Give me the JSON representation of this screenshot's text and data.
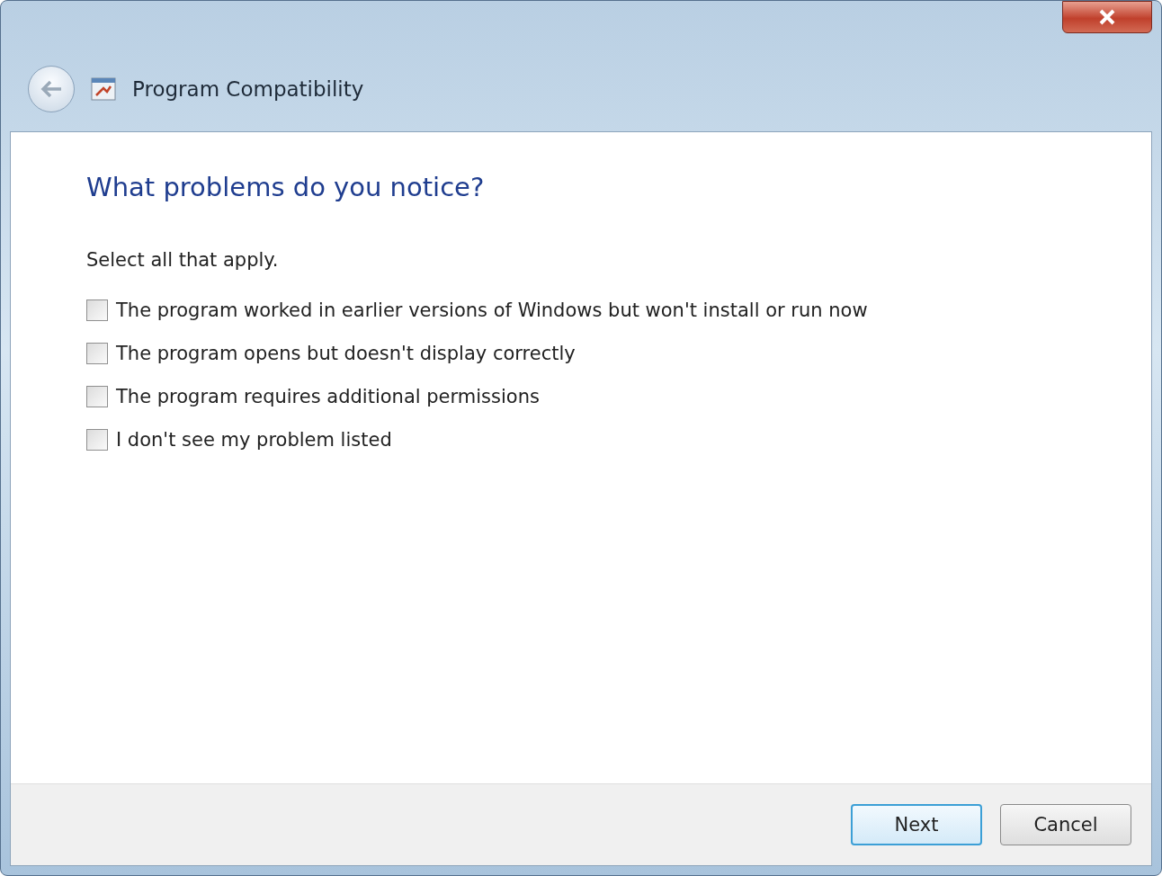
{
  "window": {
    "title": "Program Compatibility"
  },
  "heading": "What problems do you notice?",
  "instruction": "Select all that apply.",
  "options": [
    {
      "label": "The program worked in earlier versions of Windows but won't install or run now",
      "checked": false
    },
    {
      "label": "The program opens but doesn't display correctly",
      "checked": false
    },
    {
      "label": "The program requires additional permissions",
      "checked": false
    },
    {
      "label": "I don't see my problem listed",
      "checked": false
    }
  ],
  "buttons": [
    {
      "label": "Next",
      "kind": "default"
    },
    {
      "label": "Cancel",
      "kind": "normal"
    }
  ]
}
